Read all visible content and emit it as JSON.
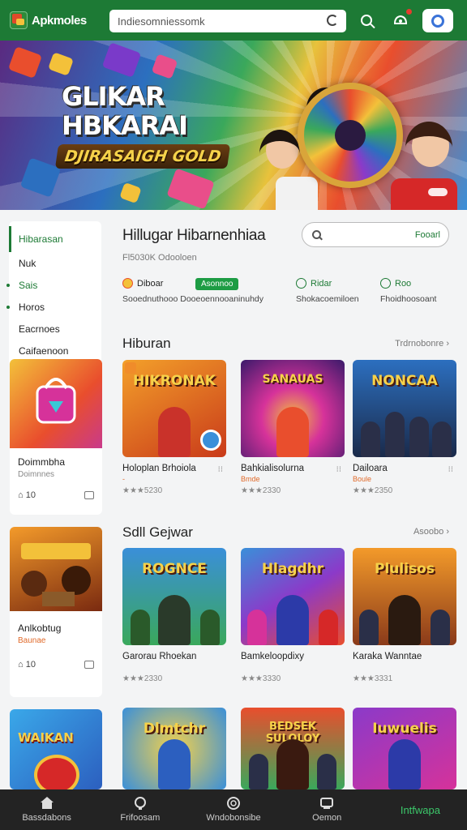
{
  "topbar": {
    "brand": "Apkmoles",
    "search_text": "Indiesomniessomk",
    "icons": [
      "search-icon",
      "notification-icon",
      "app-icon"
    ],
    "accent_color": "#1d7a35"
  },
  "hero": {
    "line1": "GLIKAR",
    "line2": "HBKARAI",
    "line3": "DJIRASAIGH GOLD"
  },
  "sidebar": {
    "items": [
      {
        "label": "Hibarasan"
      },
      {
        "label": "Nuk"
      },
      {
        "label": "Sais"
      },
      {
        "label": "Horos"
      },
      {
        "label": "Eacrnoes"
      },
      {
        "label": "Caifaenoon"
      }
    ],
    "cards": [
      {
        "title": "Doimmbha",
        "subtitle": "Doimnnes",
        "count": "10"
      },
      {
        "title": "Anlkobtug",
        "subtitle": "Baunae",
        "count": "10"
      },
      {
        "title": "WAIKAN"
      }
    ]
  },
  "main": {
    "heading": "Hillugar Hibarnenhiaa",
    "subheading": "Fl5030K Odooloen",
    "search_label": "Fooarl",
    "tags": [
      {
        "label": "Diboar",
        "sub": "Sooednuthooo Dooeoennooaninuhdy"
      },
      {
        "badge": "Asonnoo"
      },
      {
        "label": "Ridar",
        "sub": "Shokacoemiloen"
      },
      {
        "label": "Roo",
        "sub": "Fhoidhoosoant"
      }
    ],
    "sections": [
      {
        "title": "Hiburan",
        "more": "Trdrnobonre",
        "items": [
          {
            "art_title": "HIKRONAK",
            "name": "Holoplan Brhoiola",
            "sub": "-",
            "rating": "★★★5230"
          },
          {
            "art_title": "SANAUAS",
            "name": "Bahkialisolurna",
            "sub": "Bmde",
            "rating": "★★★2330"
          },
          {
            "art_title": "NONCAA",
            "name": "Dailoara",
            "sub": "Boule",
            "rating": "★★★2350"
          }
        ]
      },
      {
        "title": "Sdll Gejwar",
        "more": "Asoobo",
        "items": [
          {
            "art_title": "ROGNCE",
            "name": "Garorau Rhoekan",
            "sub": "",
            "rating": "★★★2330"
          },
          {
            "art_title": "Hlagdhr",
            "name": "Bamkeloopdixy",
            "sub": "",
            "rating": "★★★3330"
          },
          {
            "art_title": "Plulisos",
            "name": "Karaka Wanntae",
            "sub": "",
            "rating": "★★★3331"
          }
        ]
      },
      {
        "title": "",
        "more": "",
        "items": [
          {
            "art_title": "Dlmtchr"
          },
          {
            "art_title": "BEDSEK SULOLOY"
          },
          {
            "art_title": "Iuwuelis"
          }
        ]
      }
    ]
  },
  "bottom_nav": [
    {
      "label": "Bassdabons",
      "icon": "home-icon"
    },
    {
      "label": "Frifoosam",
      "icon": "chat-icon"
    },
    {
      "label": "Wndobonsibe",
      "icon": "coin-icon"
    },
    {
      "label": "Oemon",
      "icon": "account-icon"
    },
    {
      "label": "Intfwapa",
      "active": true
    }
  ]
}
